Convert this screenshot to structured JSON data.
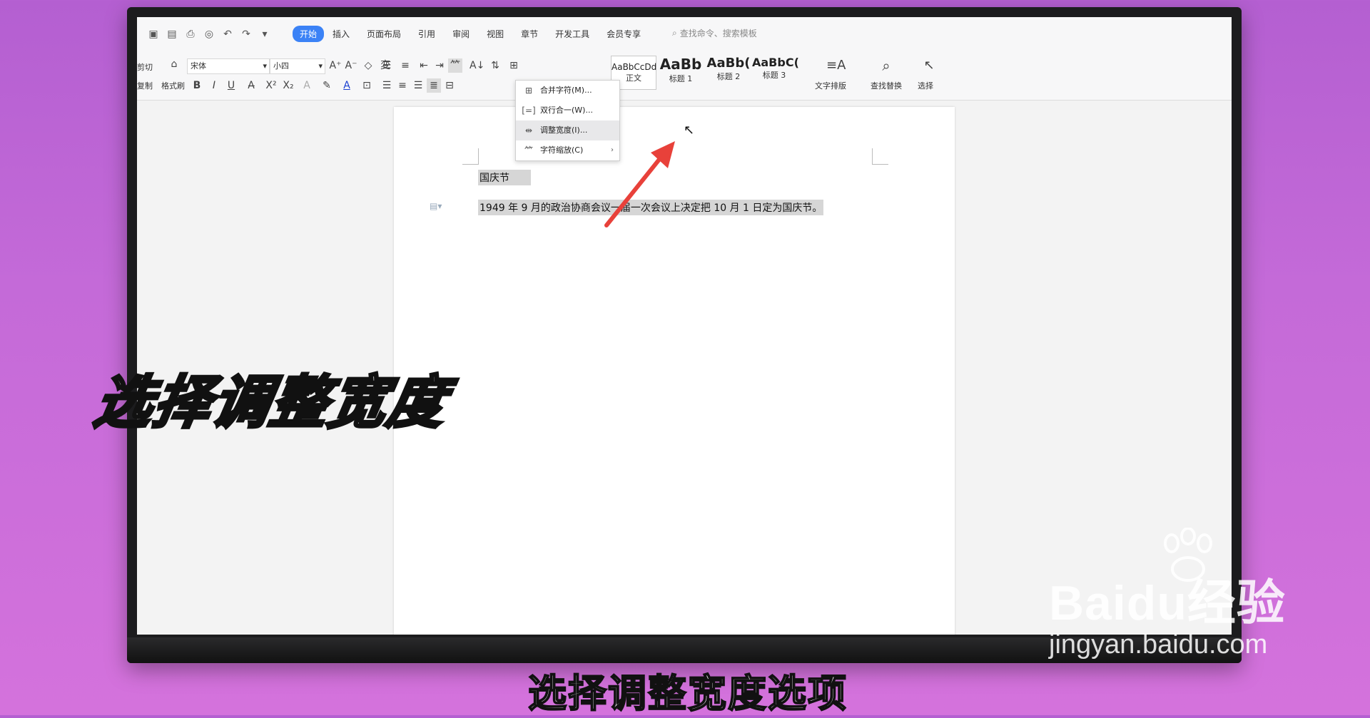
{
  "quick_access": [
    "save-icon",
    "template-icon",
    "print-icon",
    "preview-icon",
    "undo-icon",
    "redo-icon",
    "more-icon"
  ],
  "tabs": [
    {
      "label": "开始",
      "active": true
    },
    {
      "label": "插入",
      "active": false
    },
    {
      "label": "页面布局",
      "active": false
    },
    {
      "label": "引用",
      "active": false
    },
    {
      "label": "审阅",
      "active": false
    },
    {
      "label": "视图",
      "active": false
    },
    {
      "label": "章节",
      "active": false
    },
    {
      "label": "开发工具",
      "active": false
    },
    {
      "label": "会员专享",
      "active": false
    }
  ],
  "search_placeholder": "查找命令、搜索模板",
  "clipboard": {
    "cut": "剪切",
    "copy": "复制",
    "format_painter": "格式刷"
  },
  "font": {
    "name": "宋体",
    "size": "小四"
  },
  "styles": [
    {
      "sample": "AaBbCcDd",
      "name": "正文"
    },
    {
      "sample": "AaBb",
      "name": "标题 1"
    },
    {
      "sample": "AaBb(",
      "name": "标题 2"
    },
    {
      "sample": "AaBbC(",
      "name": "标题 3"
    }
  ],
  "right_tools": {
    "text_layout": "文字排版",
    "find_replace": "查找替换",
    "select": "选择"
  },
  "dropdown": [
    {
      "label": "合并字符(M)...",
      "icon": "merge-chars-icon",
      "hover": false
    },
    {
      "label": "双行合一(W)...",
      "icon": "two-lines-icon",
      "hover": false
    },
    {
      "label": "调整宽度(I)...",
      "icon": "adjust-width-icon",
      "hover": true
    },
    {
      "label": "字符缩放(C)",
      "icon": "char-scale-icon",
      "hover": false
    }
  ],
  "document": {
    "line1": "国庆节",
    "line2": "1949 年 9 月的政治协商会议一届一次会议上决定把 10 月 1 日定为国庆节。"
  },
  "big_caption": "选择调整宽度",
  "sub_caption": "选择调整宽度选项",
  "watermark": {
    "logo": "Baidu经验",
    "url": "jingyan.baidu.com"
  }
}
